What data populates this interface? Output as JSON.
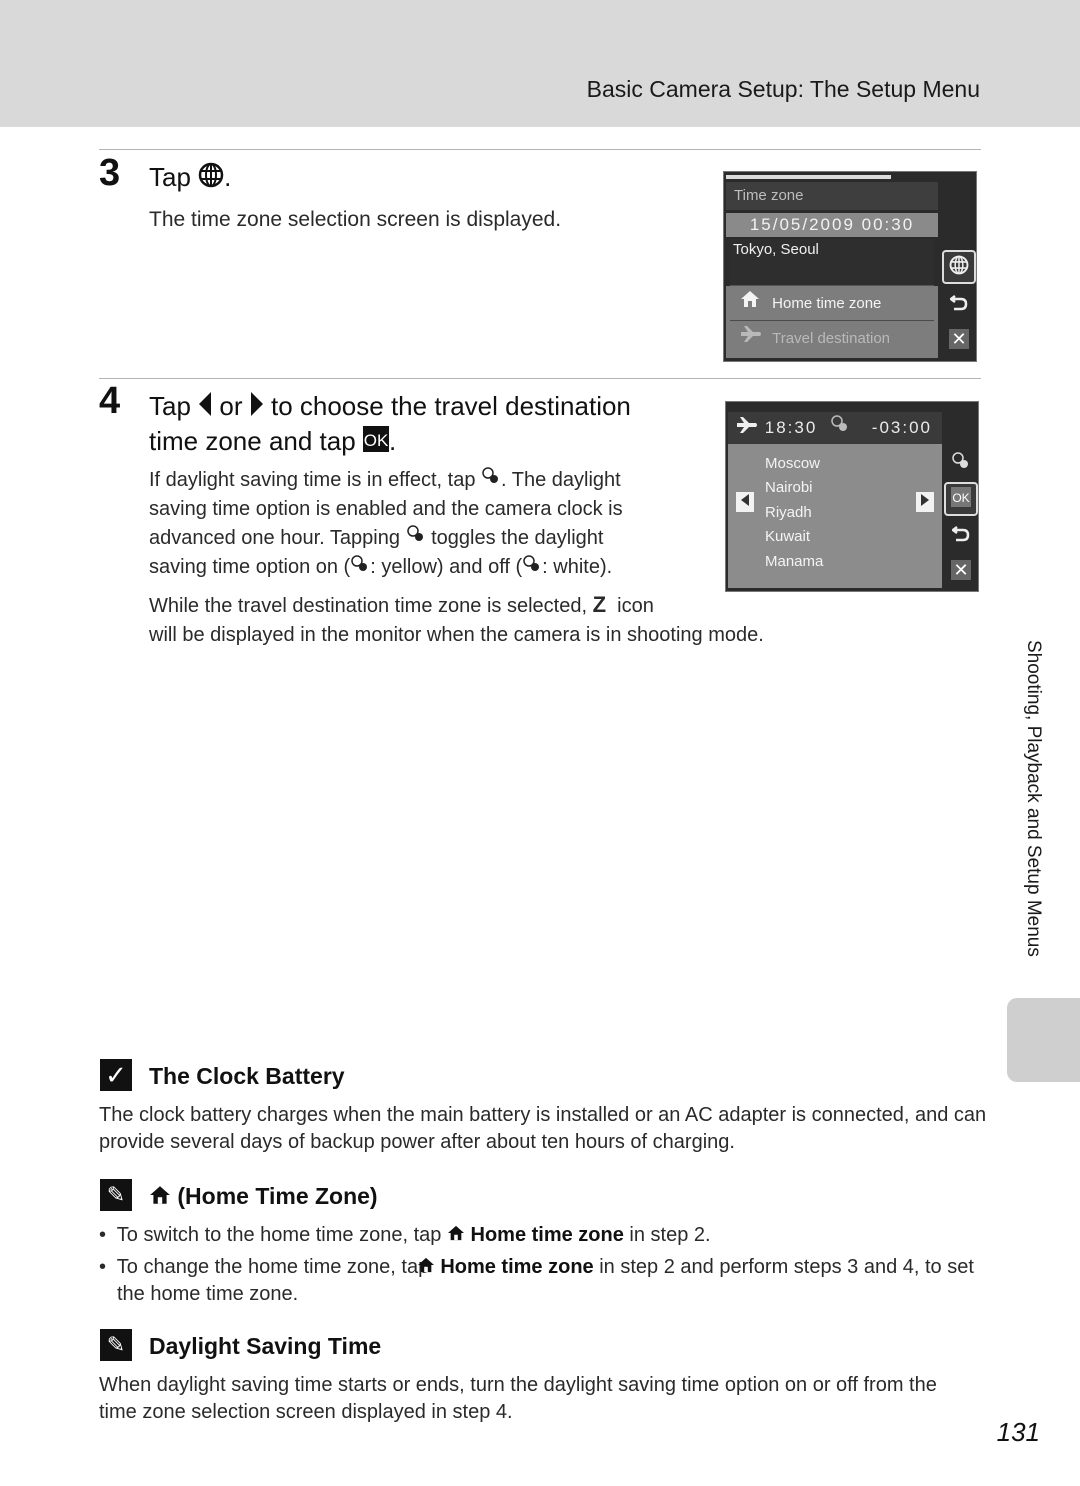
{
  "header": {
    "title": "Basic Camera Setup: The Setup Menu"
  },
  "step3": {
    "number": "3",
    "title_prefix": "Tap",
    "title_suffix": ".",
    "icon": "globe-icon",
    "description": "The time zone selection screen is displayed."
  },
  "screen1": {
    "title": "Time zone",
    "datetime": "15/05/2009 00:30",
    "zone": "Tokyo, Seoul",
    "menu": [
      {
        "label": "Home time zone",
        "icon": "home-icon",
        "state": "enabled"
      },
      {
        "label": "Travel destination",
        "icon": "airplane-icon",
        "state": "dimmed"
      }
    ],
    "side_buttons": [
      "globe-icon",
      "back-icon",
      "close-icon"
    ]
  },
  "step4": {
    "number": "4",
    "title_line1_a": "Tap",
    "title_line1_b": "or",
    "title_line1_c": "to choose the travel destination",
    "title_line2": "time zone and tap",
    "title_line2_end": ".",
    "para1_a": "If daylight saving time is in effect, tap",
    "para1_b": ". The daylight",
    "para1_c": "saving time option is enabled and the camera clock is",
    "para1_d": "advanced one hour. Tapping",
    "para1_e": "toggles the daylight",
    "para1_f": "saving time option on (",
    "para1_g": ": yellow) and off (",
    "para1_h": ": white).",
    "para2_a": "While the travel destination time zone is selected,",
    "para2_glyph": "Z",
    "para2_b": "icon",
    "para2_c": "will be displayed in the monitor when the camera is in shooting mode."
  },
  "screen2": {
    "time": "18:30",
    "offset": "-03:00",
    "cities": [
      "Moscow",
      "Nairobi",
      "Riyadh",
      "Kuwait",
      "Manama"
    ],
    "side_buttons": [
      "dst-icon",
      "ok-icon",
      "back-icon",
      "close-icon"
    ]
  },
  "side_tab": {
    "label": "Shooting, Playback and Setup Menus"
  },
  "notes": {
    "clock_battery": {
      "title": "The Clock Battery",
      "text": "The clock battery charges when the main battery is installed or an AC adapter is connected, and can provide several days of backup power after about ten hours of charging."
    },
    "home_time_zone": {
      "title": "(Home Time Zone)",
      "bullets": [
        {
          "pre": "To switch to the home time zone, tap",
          "bold": "Home time zone",
          "post": "in step 2."
        },
        {
          "pre": "To change the home time zone, tap",
          "bold": "Home time zone",
          "post": "in step 2 and perform steps 3 and 4, to set the home time zone."
        }
      ]
    },
    "dst": {
      "title": "Daylight Saving Time",
      "text": "When daylight saving time starts or ends, turn the daylight saving time option on or off from the time zone selection screen displayed in step 4."
    }
  },
  "page_number": "131"
}
